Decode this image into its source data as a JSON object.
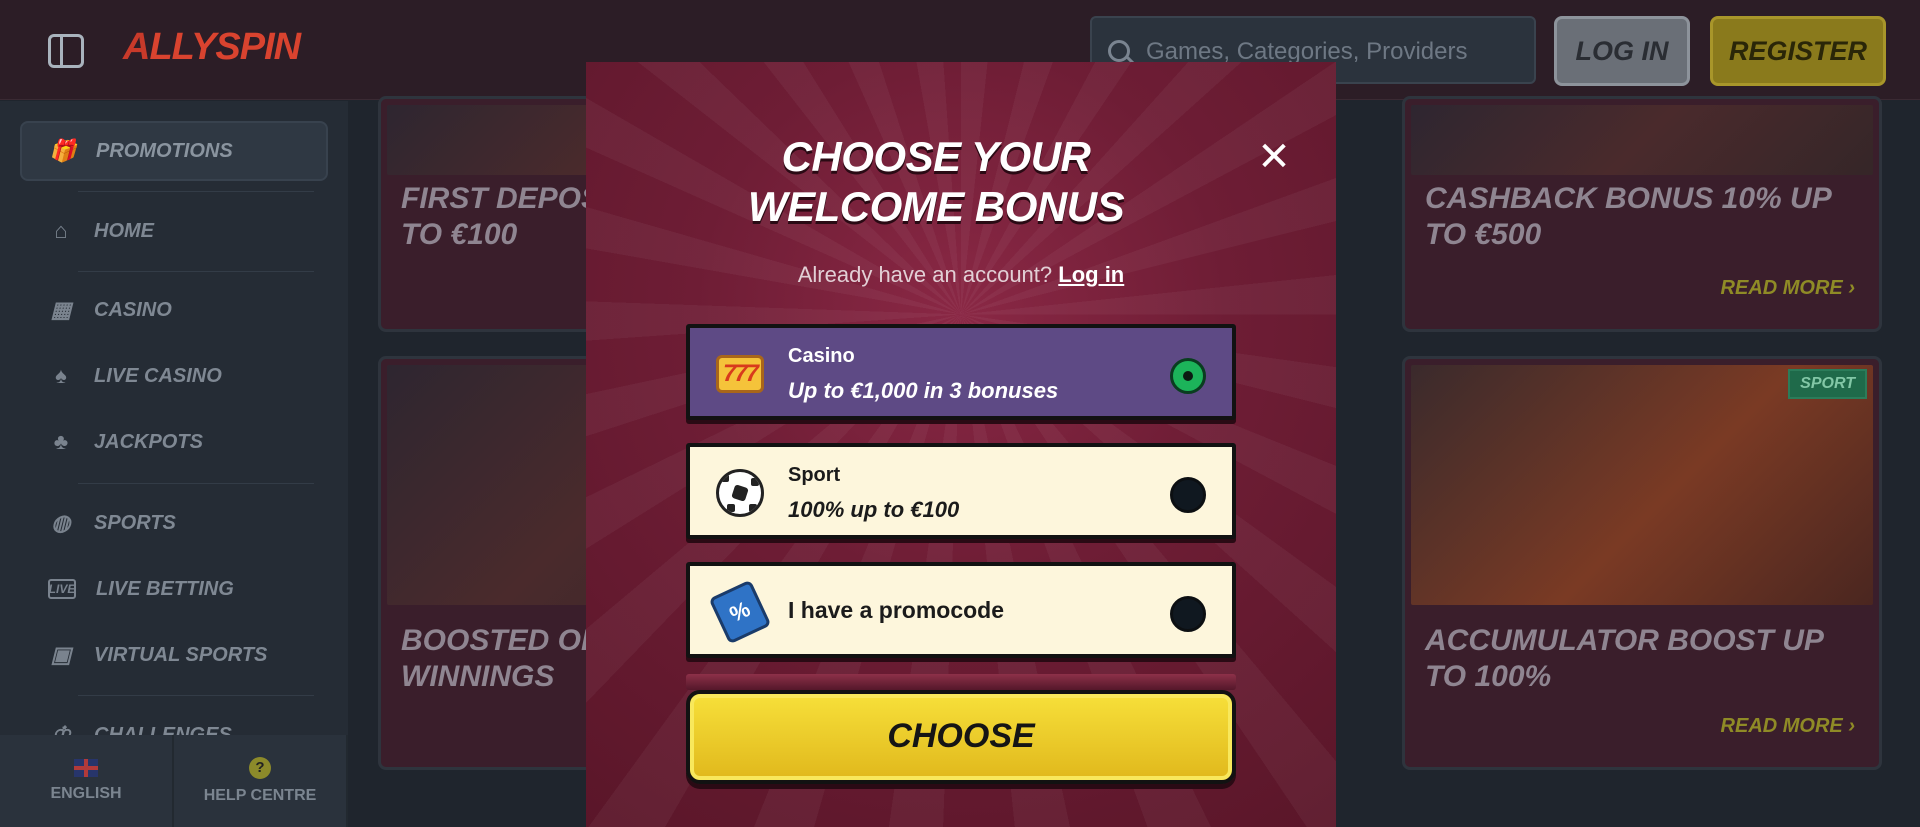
{
  "header": {
    "logo": {
      "a": "A",
      "rest": "LLYSPIN"
    },
    "search_placeholder": "Games, Categories, Providers",
    "login_label": "LOG IN",
    "register_label": "REGISTER"
  },
  "sidebar": {
    "items": [
      {
        "label": "PROMOTIONS",
        "icon": "gift-icon"
      },
      {
        "label": "HOME",
        "icon": "home-icon"
      },
      {
        "label": "CASINO",
        "icon": "slot-machine-icon"
      },
      {
        "label": "LIVE CASINO",
        "icon": "cards-icon"
      },
      {
        "label": "JACKPOTS",
        "icon": "clover-icon"
      },
      {
        "label": "SPORTS",
        "icon": "football-icon"
      },
      {
        "label": "LIVE BETTING",
        "icon": "live-icon"
      },
      {
        "label": "VIRTUAL SPORTS",
        "icon": "virtual-sports-icon"
      },
      {
        "label": "CHALLENGES",
        "icon": "trophy-icon"
      }
    ],
    "footer": {
      "language": "ENGLISH",
      "help": "HELP CENTRE"
    }
  },
  "cards": [
    {
      "title": "FIRST DEPOSIT BONUS 100% UP TO €100",
      "visible_title": "FIRST DEPOSIT\nTO €100"
    },
    {
      "title": "CASHBACK BONUS 10% UP TO €500",
      "visible_title": "CASHBACK BONUS 10% UP TO €500",
      "more": "READ MORE"
    },
    {
      "title": "BOOSTED ODDS",
      "visible_title": "BOOSTED ODD\nWINNINGS",
      "tag": "SPORT"
    },
    {
      "title": "ACCUMULATOR BOOST UP TO 100%",
      "visible_title": "ACCUMULATOR BOOST UP TO 100%",
      "tag": "SPORT",
      "more": "READ MORE"
    }
  ],
  "modal": {
    "title": "CHOOSE YOUR WELCOME BONUS",
    "already_text": "Already have an account?",
    "login_link": "Log in",
    "options": [
      {
        "label": "Casino",
        "sub": "Up to €1,000 in 3 bonuses",
        "selected": true,
        "icon": "slot-777-icon",
        "icon_text": "777"
      },
      {
        "label": "Sport",
        "sub": "100% up to €100",
        "selected": false,
        "icon": "soccer-ball-icon"
      },
      {
        "label": "I have a promocode",
        "selected": false,
        "icon": "promo-tag-icon",
        "icon_text": "%"
      }
    ],
    "choose_label": "CHOOSE"
  },
  "colors": {
    "modal_bg": "#6e1d35",
    "selected_option": "#5e4a85",
    "option_bg": "#fdf6dc",
    "choose_yellow": "#f0cc2a",
    "radio_on": "#1cb45a"
  }
}
